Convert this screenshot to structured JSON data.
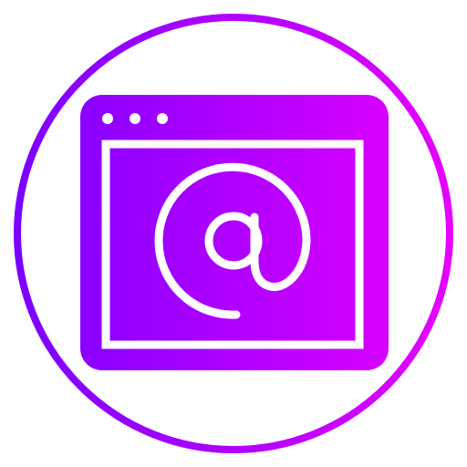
{
  "icon": {
    "name": "web-email-icon",
    "description_hidden": "",
    "gradient": {
      "start": "#7a00ff",
      "end": "#e600ff"
    },
    "background": "#ffffff",
    "window_dots": 3
  }
}
